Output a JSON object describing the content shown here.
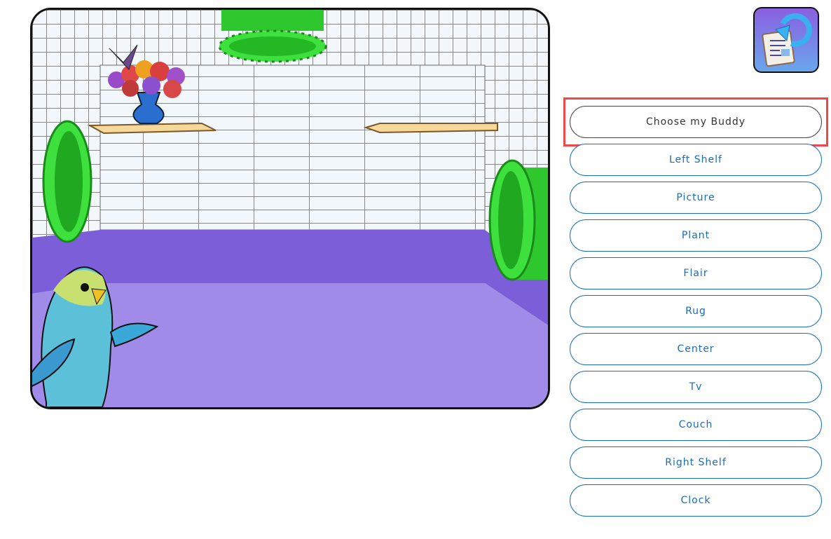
{
  "toolbar": {
    "reset_icon": "reset-room-icon"
  },
  "buttons": [
    {
      "label": "Choose my Buddy",
      "highlighted": true
    },
    {
      "label": "Left Shelf"
    },
    {
      "label": "Picture"
    },
    {
      "label": "Plant"
    },
    {
      "label": "Flair"
    },
    {
      "label": "Rug"
    },
    {
      "label": "Center"
    },
    {
      "label": "Tv"
    },
    {
      "label": "Couch"
    },
    {
      "label": "Right Shelf"
    },
    {
      "label": "Clock"
    }
  ],
  "colors": {
    "accent": "#1a6cb8",
    "highlight": "#f04848",
    "floor": "#a08ce8",
    "tube": "#3cd83c"
  }
}
